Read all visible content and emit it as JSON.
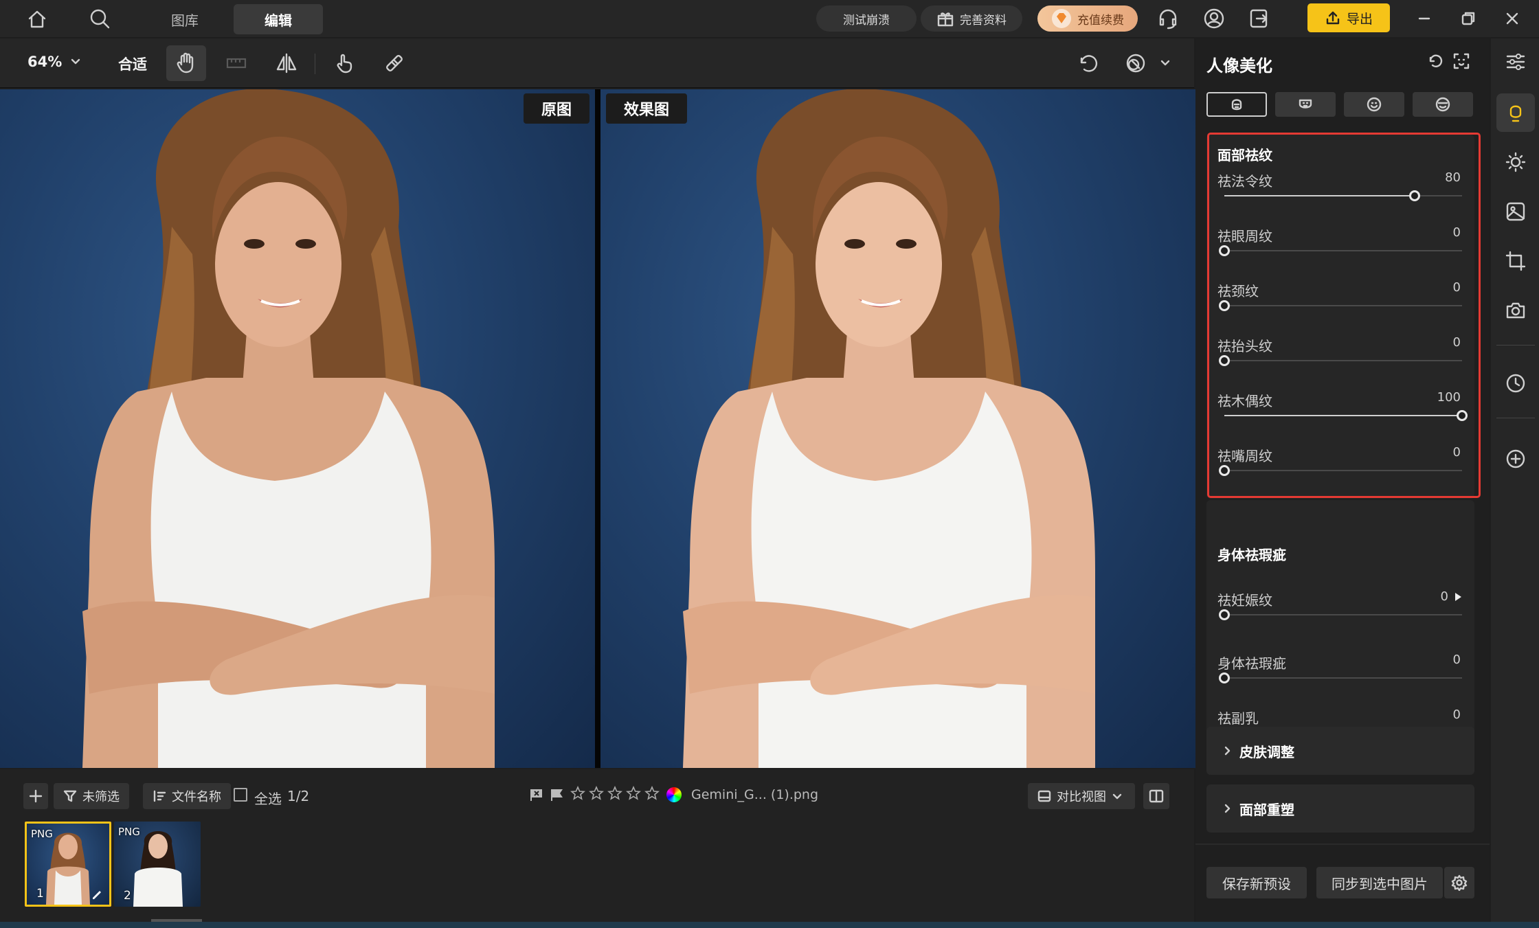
{
  "topbar": {
    "tabs": [
      {
        "label": "图库"
      },
      {
        "label": "编辑"
      }
    ],
    "crash_test": "测试崩溃",
    "complete_info": "完善资料",
    "recharge": "充值续费",
    "export": "导出"
  },
  "toolbar": {
    "zoom": "64%",
    "fit": "合适"
  },
  "canvas": {
    "original_label": "原图",
    "result_label": "效果图",
    "background_color": "#21416b"
  },
  "strip": {
    "filter": "未筛选",
    "sort": "文件名称",
    "select_all": "全选",
    "count": "1/2",
    "rating_stars": 0,
    "filename": "Gemini_G... (1).png",
    "compare_view": "对比视图",
    "thumbnails": [
      {
        "badge": "PNG",
        "number": "1"
      },
      {
        "badge": "PNG",
        "number": "2"
      }
    ]
  },
  "panel": {
    "title": "人像美化",
    "face_section": {
      "title": "面部祛纹",
      "sliders": [
        {
          "label": "祛法令纹",
          "value": "80"
        },
        {
          "label": "祛眼周纹",
          "value": "0"
        },
        {
          "label": "祛颈纹",
          "value": "0"
        },
        {
          "label": "祛抬头纹",
          "value": "0"
        },
        {
          "label": "祛木偶纹",
          "value": "100"
        },
        {
          "label": "祛嘴周纹",
          "value": "0"
        }
      ]
    },
    "body_section": {
      "title": "身体祛瑕疵",
      "sliders": [
        {
          "label": "祛妊娠纹",
          "value": "0"
        },
        {
          "label": "身体祛瑕疵",
          "value": "0"
        },
        {
          "label": "祛副乳",
          "value": "0"
        }
      ]
    },
    "skin_adjust": "皮肤调整",
    "face_reshape": "面部重塑",
    "save_preset": "保存新预设",
    "sync_selected": "同步到选中图片"
  },
  "colors": {
    "accent": "#f6c318",
    "highlight": "#e53a33"
  }
}
